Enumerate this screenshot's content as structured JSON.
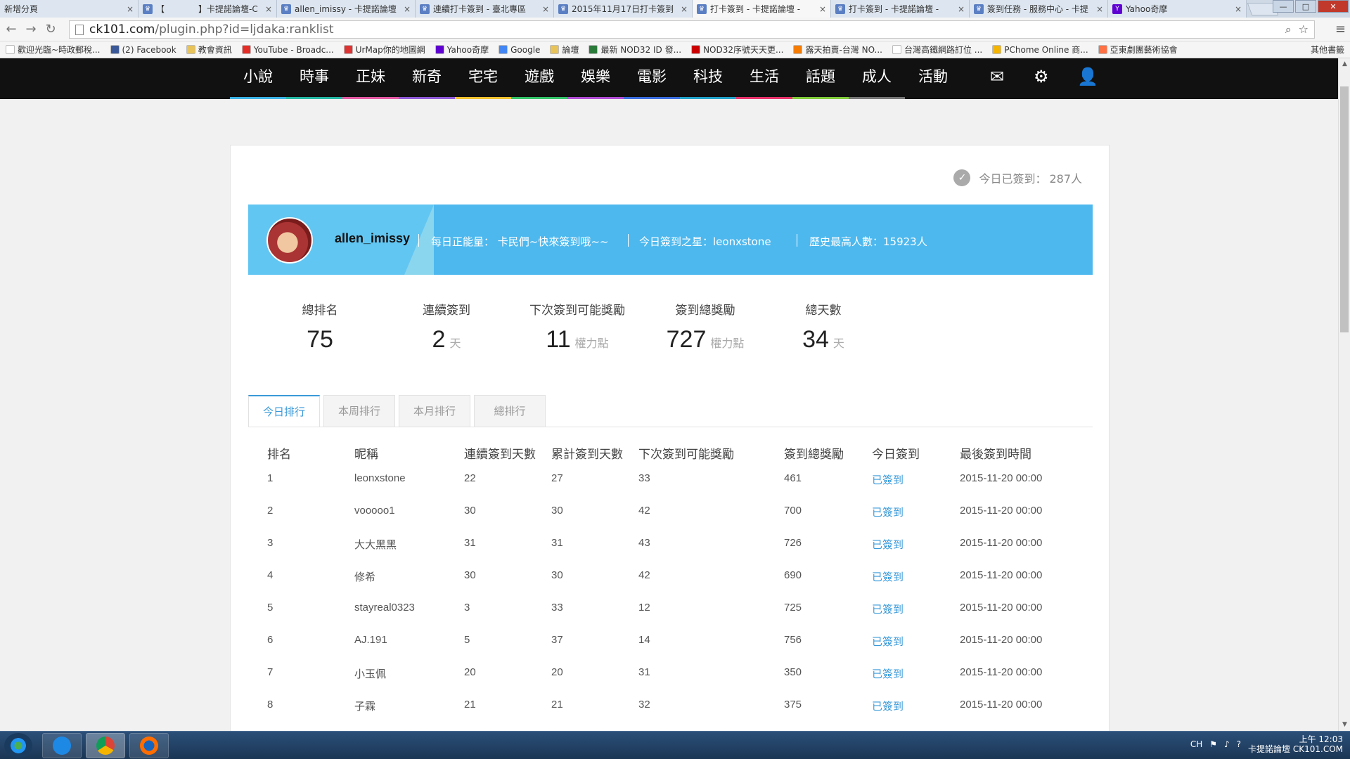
{
  "browser": {
    "tabs": [
      {
        "title": "新增分頁",
        "icon": "none",
        "active": false
      },
      {
        "title": "【　　　　】卡提諾論壇-C",
        "icon": "ck",
        "active": false
      },
      {
        "title": "allen_imissy - 卡提諾論壇",
        "icon": "ck",
        "active": false
      },
      {
        "title": "連續打卡簽到 - 臺北專區",
        "icon": "ck",
        "active": false
      },
      {
        "title": "2015年11月17日打卡簽到",
        "icon": "ck",
        "active": false
      },
      {
        "title": "打卡簽到 - 卡提諾論壇 -",
        "icon": "ck",
        "active": true
      },
      {
        "title": "打卡簽到 - 卡提諾論壇 -",
        "icon": "ck",
        "active": false
      },
      {
        "title": "簽到任務 - 服務中心 - 卡提",
        "icon": "ck",
        "active": false
      },
      {
        "title": "Yahoo奇摩",
        "icon": "yahoo",
        "active": false
      }
    ],
    "url_domain": "ck101.com",
    "url_path": "/plugin.php?id=ljdaka:ranklist",
    "bookmarks": [
      {
        "label": "歡迎光臨~時政郵稅...",
        "color": "#ffffff"
      },
      {
        "label": "(2) Facebook",
        "color": "#3b5998"
      },
      {
        "label": "教會資訊",
        "color": "#e8c35a"
      },
      {
        "label": "YouTube - Broadc...",
        "color": "#e52d27"
      },
      {
        "label": "UrMap你的地圖網",
        "color": "#d33"
      },
      {
        "label": "Yahoo奇摩",
        "color": "#5f01d1"
      },
      {
        "label": "Google",
        "color": "#4285f4"
      },
      {
        "label": "論壇",
        "color": "#e8c35a"
      },
      {
        "label": "最新 NOD32 ID 發...",
        "color": "#2a7a3a"
      },
      {
        "label": "NOD32序號天天更...",
        "color": "#c00"
      },
      {
        "label": "露天拍賣-台灣 NO...",
        "color": "#f57c00"
      },
      {
        "label": "台灣高鐵網路訂位 ...",
        "color": "#ffffff"
      },
      {
        "label": "PChome Online 商...",
        "color": "#f4b400"
      },
      {
        "label": "亞東劇團藝術協會",
        "color": "#ff7043"
      }
    ],
    "other_bookmarks": "其他書籤"
  },
  "site_nav": {
    "items": [
      {
        "label": "小說",
        "color": "#3bb3e6"
      },
      {
        "label": "時事",
        "color": "#25b8a5"
      },
      {
        "label": "正妹",
        "color": "#e45aa3"
      },
      {
        "label": "新奇",
        "color": "#8e5ad8"
      },
      {
        "label": "宅宅",
        "color": "#f2c230"
      },
      {
        "label": "遊戲",
        "color": "#35c46a"
      },
      {
        "label": "娛樂",
        "color": "#b14dd6"
      },
      {
        "label": "電影",
        "color": "#3b6fe0"
      },
      {
        "label": "科技",
        "color": "#22a3c9"
      },
      {
        "label": "生活",
        "color": "#e8346b"
      },
      {
        "label": "話題",
        "color": "#7fcc3a"
      },
      {
        "label": "成人",
        "color": "#777777"
      },
      {
        "label": "活動",
        "color": "#111111"
      }
    ],
    "icons": [
      "mail-icon",
      "gear-icon",
      "user-icon"
    ],
    "icon_glyphs": {
      "mail": "✉",
      "gear": "⚙",
      "user": "👤"
    }
  },
  "summary": {
    "checked_today_label": "今日已簽到：",
    "checked_today_count": "287人"
  },
  "banner": {
    "username": "allen_imissy",
    "daily_energy": "每日正能量： 卡民們~快來簽到哦~~",
    "star_of_day": "今日簽到之星：leonxstone",
    "record": "歷史最高人數：15923人"
  },
  "stats": [
    {
      "label": "總排名",
      "value": "75",
      "unit": ""
    },
    {
      "label": "連續簽到",
      "value": "2",
      "unit": "天"
    },
    {
      "label": "下次簽到可能獎勵",
      "value": "11",
      "unit": "權力點"
    },
    {
      "label": "簽到總獎勵",
      "value": "727",
      "unit": "權力點"
    },
    {
      "label": "總天數",
      "value": "34",
      "unit": "天"
    }
  ],
  "rank_tabs": [
    "今日排行",
    "本周排行",
    "本月排行",
    "總排行"
  ],
  "table": {
    "headers": [
      "排名",
      "昵稱",
      "連續簽到天數",
      "累計簽到天數",
      "下次簽到可能獎勵",
      "簽到總獎勵",
      "今日簽到",
      "最後簽到時間"
    ],
    "rows": [
      [
        "1",
        "leonxstone",
        "22",
        "27",
        "33",
        "461",
        "已簽到",
        "2015-11-20 00:00"
      ],
      [
        "2",
        "vooooo1",
        "30",
        "30",
        "42",
        "700",
        "已簽到",
        "2015-11-20 00:00"
      ],
      [
        "3",
        "大大黑黑",
        "31",
        "31",
        "43",
        "726",
        "已簽到",
        "2015-11-20 00:00"
      ],
      [
        "4",
        "修希",
        "30",
        "30",
        "42",
        "690",
        "已簽到",
        "2015-11-20 00:00"
      ],
      [
        "5",
        "stayreal0323",
        "3",
        "33",
        "12",
        "725",
        "已簽到",
        "2015-11-20 00:00"
      ],
      [
        "6",
        "AJ.191",
        "5",
        "37",
        "14",
        "756",
        "已簽到",
        "2015-11-20 00:00"
      ],
      [
        "7",
        "小玉佩",
        "20",
        "20",
        "31",
        "350",
        "已簽到",
        "2015-11-20 00:00"
      ],
      [
        "8",
        "子霖",
        "21",
        "21",
        "32",
        "375",
        "已簽到",
        "2015-11-20 00:00"
      ]
    ]
  },
  "taskbar": {
    "tray_lang": "CH",
    "clock_time": "上午 12:03",
    "tray_text": "卡提諾論壇 CK101.COM"
  }
}
